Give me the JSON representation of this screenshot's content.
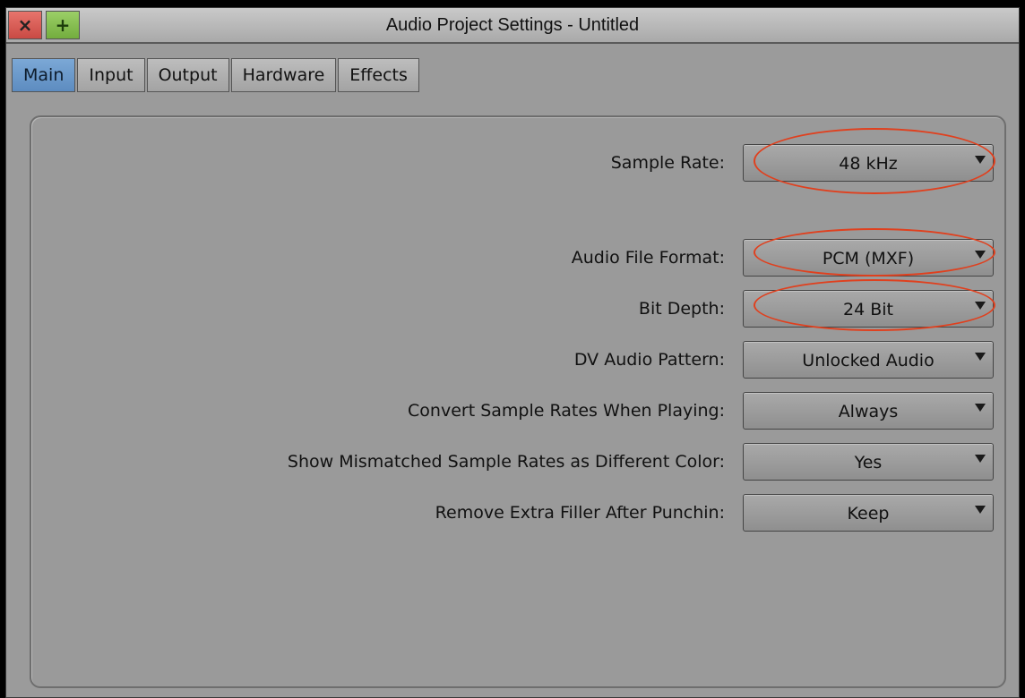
{
  "window": {
    "title": "Audio Project Settings - Untitled",
    "close_glyph": "×",
    "add_glyph": "+"
  },
  "tabs": [
    {
      "label": "Main",
      "active": true
    },
    {
      "label": "Input",
      "active": false
    },
    {
      "label": "Output",
      "active": false
    },
    {
      "label": "Hardware",
      "active": false
    },
    {
      "label": "Effects",
      "active": false
    }
  ],
  "settings": [
    {
      "label": "Sample Rate:",
      "value": "48 kHz"
    },
    {
      "label": "Audio File Format:",
      "value": "PCM  (MXF)"
    },
    {
      "label": "Bit Depth:",
      "value": "24 Bit"
    },
    {
      "label": "DV Audio Pattern:",
      "value": "Unlocked Audio"
    },
    {
      "label": "Convert Sample Rates When Playing:",
      "value": "Always"
    },
    {
      "label": "Show Mismatched Sample Rates as Different Color:",
      "value": "Yes"
    },
    {
      "label": "Remove Extra Filler After Punchin:",
      "value": "Keep"
    }
  ],
  "colors": {
    "active_tab": "#6a98c9",
    "highlight_ellipse": "#e0401e",
    "close_button": "#d85a52",
    "add_button": "#86bd52"
  },
  "icons": {
    "close": "close-icon",
    "add": "plus-icon",
    "dropdown": "chevron-down-icon"
  }
}
